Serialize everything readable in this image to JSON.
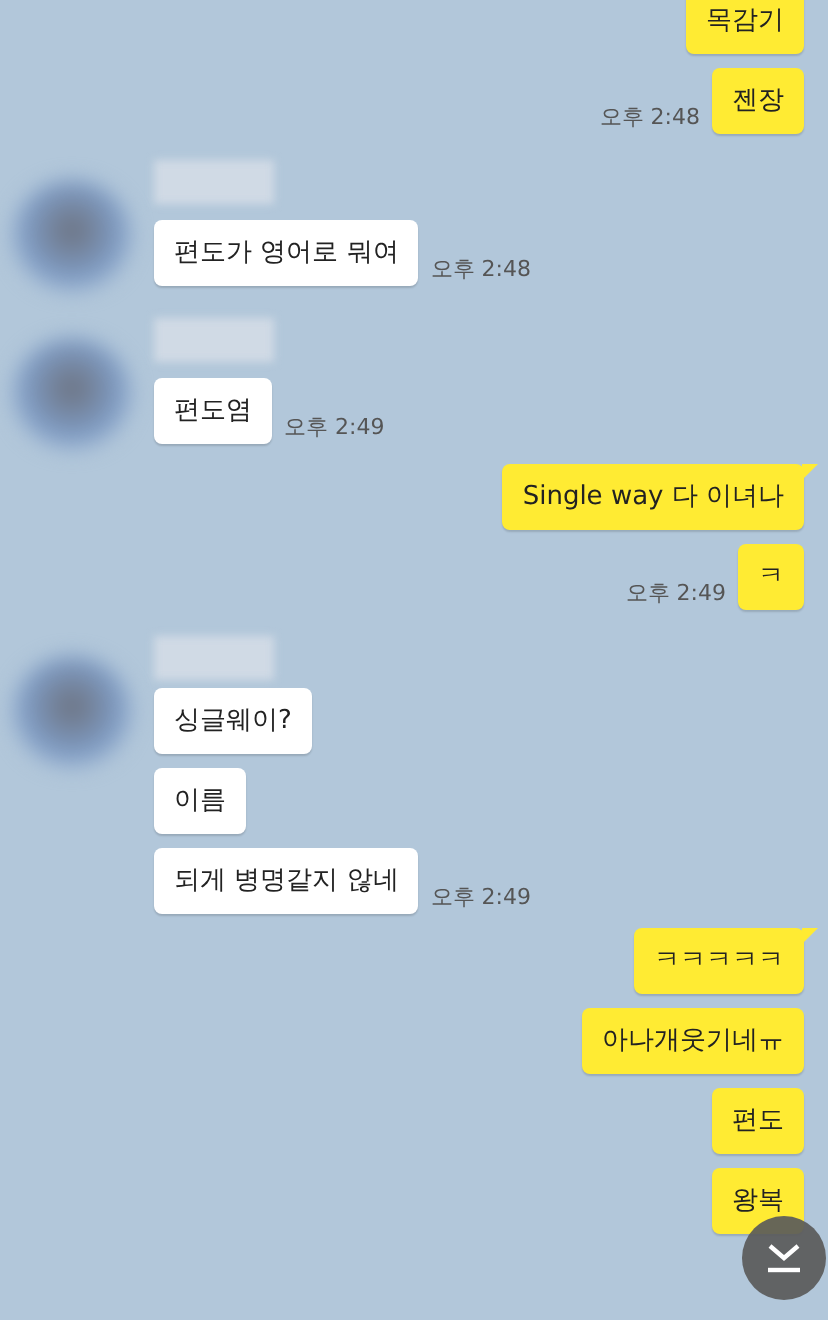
{
  "messages": [
    {
      "kind": "outgoing",
      "text": "목감기",
      "tail": false
    },
    {
      "kind": "outgoing",
      "text": "젠장",
      "tail": false,
      "time": "오후 2:48"
    },
    {
      "kind": "incoming_group",
      "messages": [
        {
          "text": "편도가 영어로 뭐여",
          "time": "오후 2:48"
        }
      ]
    },
    {
      "kind": "incoming_group",
      "messages": [
        {
          "text": "편도염",
          "time": "오후 2:49"
        }
      ]
    },
    {
      "kind": "outgoing",
      "text": "Single way 다 이녀나",
      "tail": true
    },
    {
      "kind": "outgoing",
      "text": "ㅋ",
      "tail": false,
      "time": "오후 2:49"
    },
    {
      "kind": "incoming_group",
      "messages": [
        {
          "text": "싱글웨이?"
        },
        {
          "text": "이름"
        },
        {
          "text": "되게 병명같지 않네",
          "time": "오후 2:49"
        }
      ]
    },
    {
      "kind": "outgoing",
      "text": "ㅋㅋㅋㅋㅋ",
      "tail": true
    },
    {
      "kind": "outgoing",
      "text": "아나개웃기네ㅠ",
      "tail": false
    },
    {
      "kind": "outgoing",
      "text": "편도",
      "tail": false
    },
    {
      "kind": "outgoing",
      "text": "왕복",
      "tail": false
    }
  ]
}
